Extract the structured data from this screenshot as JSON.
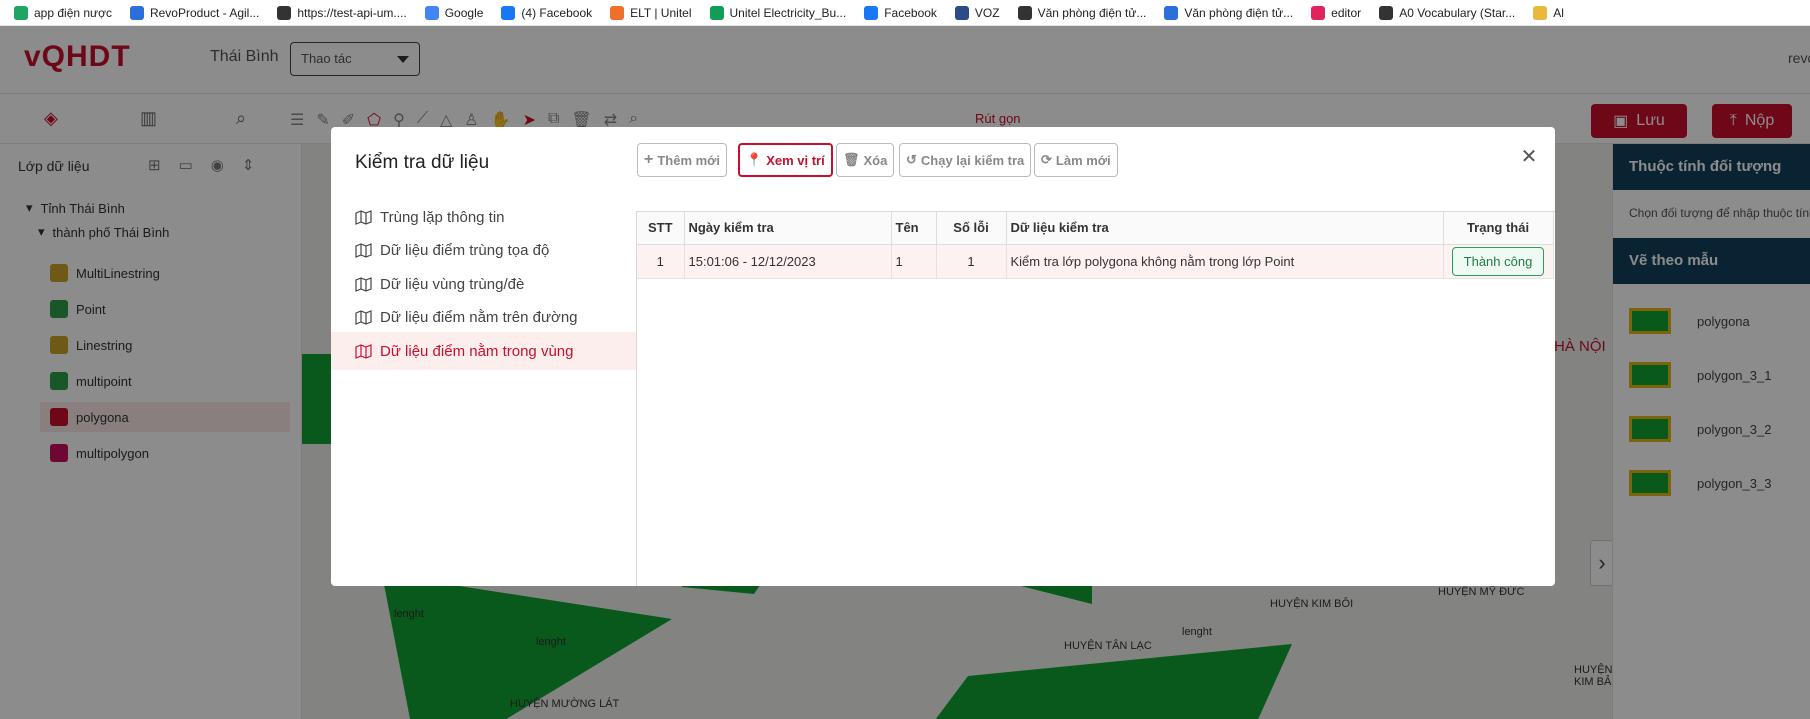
{
  "bookmarks": [
    {
      "label": "app điện nược",
      "icon": "google-drive-icon",
      "color": "#1fa463"
    },
    {
      "label": "RevoProduct - Agil...",
      "icon": "diamond-icon",
      "color": "#2a6fdb"
    },
    {
      "label": "https://test-api-um....",
      "icon": "globe-icon",
      "color": "#333333"
    },
    {
      "label": "Google",
      "icon": "google-icon",
      "color": "#4285f4"
    },
    {
      "label": "(4) Facebook",
      "icon": "facebook-icon",
      "color": "#1877f2"
    },
    {
      "label": "ELT | Unitel",
      "icon": "unitel-icon",
      "color": "#f0702a"
    },
    {
      "label": "Unitel Electricity_Bu...",
      "icon": "sheets-icon",
      "color": "#0f9d58"
    },
    {
      "label": "Facebook",
      "icon": "facebook-icon",
      "color": "#1877f2"
    },
    {
      "label": "VOZ",
      "icon": "voz-icon",
      "color": "#2b4a8a"
    },
    {
      "label": "Văn phòng điện tử...",
      "icon": "globe-icon",
      "color": "#333333"
    },
    {
      "label": "Văn phòng điện tử...",
      "icon": "v-icon",
      "color": "#2a6fdb"
    },
    {
      "label": "editor",
      "icon": "editor-icon",
      "color": "#e0245e"
    },
    {
      "label": "A0 Vocabulary (Star...",
      "icon": "globe-icon",
      "color": "#333333"
    },
    {
      "label": "Al",
      "icon": "folder-icon",
      "color": "#e8b93a"
    }
  ],
  "app": {
    "logo": "vQHDT",
    "province": "Thái Bình",
    "action_select": "Thao tác",
    "user": "revo",
    "collapse_label": "Rút gọn",
    "save_label": "Lưu",
    "submit_label": "Nộp"
  },
  "left_panel": {
    "title": "Lớp dữ liệu",
    "tree_root": "Tỉnh Thái Bình",
    "tree_child": "thành phố Thái Bình",
    "layers": [
      {
        "label": "MultiLinestring",
        "color": "#c9a227"
      },
      {
        "label": "Point",
        "color": "#2e9e4a"
      },
      {
        "label": "Linestring",
        "color": "#c9a227"
      },
      {
        "label": "multipoint",
        "color": "#2e9e4a"
      },
      {
        "label": "polygona",
        "color": "#c8102e"
      },
      {
        "label": "multipolygon",
        "color": "#c8105e"
      }
    ]
  },
  "map_labels": [
    "HUYỆN KIM BÔI",
    "HUYỆN MỸ ĐỨC",
    "HUYỆN TÂN LẠC",
    "HUYỆN MƯỜNG LÁT",
    "HÀ NỘI",
    "HUYỆN KIM BẢ",
    "lenght"
  ],
  "right_panel": {
    "title": "Thuộc tính đối tượng",
    "hint": "Chọn đối tượng để nhập thuộc tính",
    "template_title": "Vẽ theo mẫu",
    "templates": [
      "polygona",
      "polygon_3_1",
      "polygon_3_2",
      "polygon_3_3"
    ]
  },
  "modal": {
    "title": "Kiểm tra dữ liệu",
    "buttons": {
      "add": "Thêm mới",
      "view_location": "Xem vị trí",
      "delete": "Xóa",
      "rerun": "Chạy lại kiểm tra",
      "refresh": "Làm mới"
    },
    "menu": [
      "Trùng lặp thông tin",
      "Dữ liệu điểm trùng tọa độ",
      "Dữ liệu vùng trùng/đè",
      "Dữ liệu điểm nằm trên đường",
      "Dữ liệu điểm nằm trong vùng"
    ],
    "active_menu_index": 4,
    "table": {
      "headers": [
        "STT",
        "Ngày kiểm tra",
        "Tên",
        "Số lỗi",
        "Dữ liệu kiểm tra",
        "Trạng thái"
      ],
      "rows": [
        {
          "stt": "1",
          "date": "15:01:06 - 12/12/2023",
          "name": "1",
          "errors": "1",
          "data": "Kiểm tra lớp polygona không nằm trong lớp Point",
          "status": "Thành công"
        }
      ]
    }
  }
}
